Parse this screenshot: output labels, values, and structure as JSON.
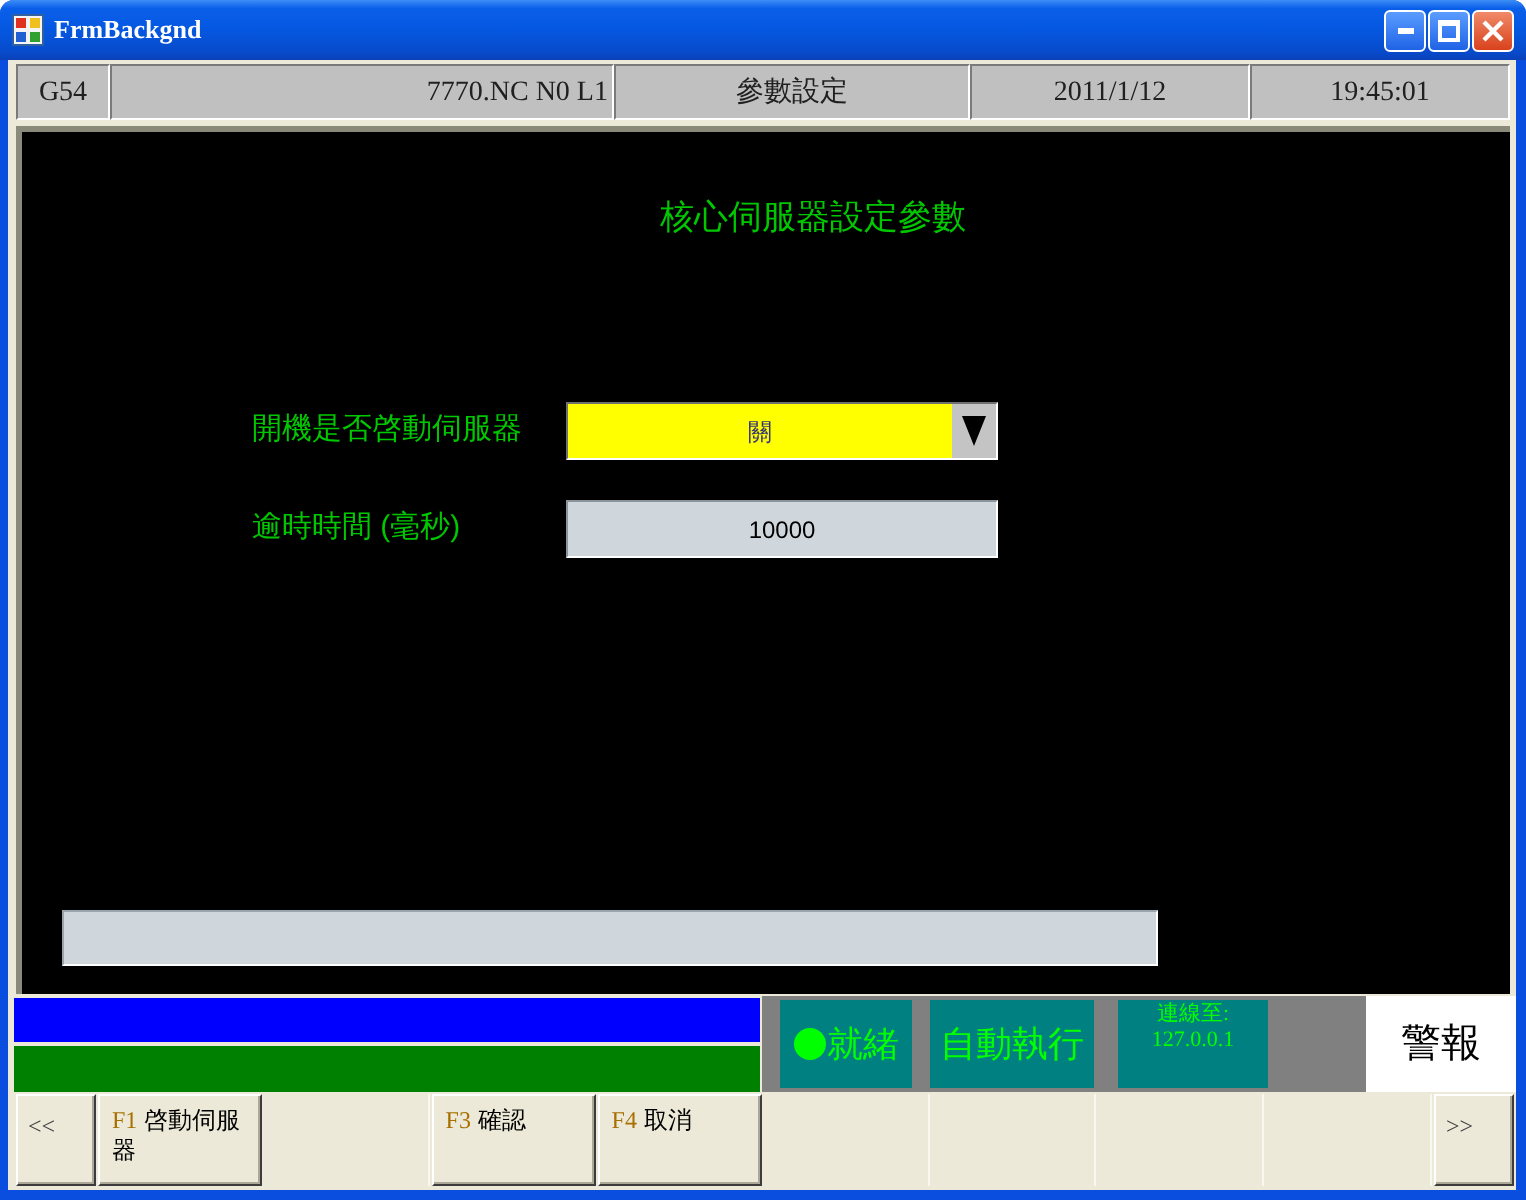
{
  "window": {
    "title": "FrmBackgnd"
  },
  "header": [
    "G54",
    "7770.NC N0 L1",
    "參數設定",
    "2011/1/12",
    "19:45:01"
  ],
  "panel": {
    "title": "核心伺服器設定參數",
    "fields": [
      {
        "kind": "dropdown",
        "label": "開機是否啓動伺服器",
        "value": "關"
      },
      {
        "kind": "input",
        "label": "逾時時間 (毫秒)",
        "value": "10000"
      }
    ]
  },
  "status": {
    "indicators": [
      {
        "kind": "ready",
        "text": "就緒"
      },
      {
        "kind": "mode",
        "text": "自動執行"
      },
      {
        "kind": "connection",
        "lines": [
          "連線至:",
          "127.0.0.1"
        ]
      }
    ],
    "alarm": "警報"
  },
  "function_keys": [
    {
      "kind": "nav",
      "text": "<<"
    },
    {
      "kind": "key",
      "key": "F1",
      "label": "啓動伺服器"
    },
    {
      "kind": "blank"
    },
    {
      "kind": "key",
      "key": "F3",
      "label": "確認"
    },
    {
      "kind": "key",
      "key": "F4",
      "label": "取消"
    },
    {
      "kind": "blank"
    },
    {
      "kind": "blank"
    },
    {
      "kind": "blank"
    },
    {
      "kind": "blank"
    },
    {
      "kind": "nav",
      "text": ">>"
    }
  ]
}
